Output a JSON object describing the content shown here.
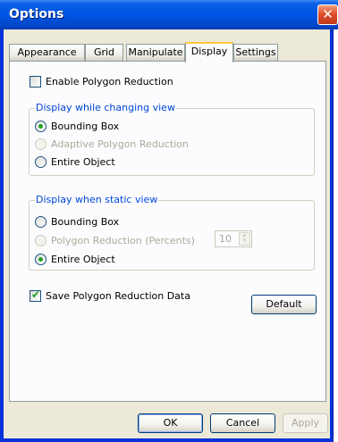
{
  "window": {
    "title": "Options",
    "close_glyph": "✕"
  },
  "tabs": [
    {
      "label": "Appearance"
    },
    {
      "label": "Grid"
    },
    {
      "label": "Manipulate"
    },
    {
      "label": "Display"
    },
    {
      "label": "Settings"
    }
  ],
  "active_tab": "Display",
  "display": {
    "enable_polygon_reduction": {
      "label": "Enable Polygon Reduction",
      "checked": false
    },
    "changing_view": {
      "title": "Display while changing view",
      "options": [
        {
          "label": "Bounding Box",
          "selected": true,
          "enabled": true
        },
        {
          "label": "Adaptive Polygon Reduction",
          "selected": false,
          "enabled": false
        },
        {
          "label": "Entire Object",
          "selected": false,
          "enabled": true
        }
      ]
    },
    "static_view": {
      "title": "Display when static view",
      "options": [
        {
          "label": "Bounding Box",
          "selected": false,
          "enabled": true
        },
        {
          "label": "Polygon Reduction (Percents)",
          "selected": false,
          "enabled": false
        },
        {
          "label": "Entire Object",
          "selected": true,
          "enabled": true
        }
      ],
      "percent_value": "10"
    },
    "save_reduction_data": {
      "label": "Save Polygon Reduction Data",
      "checked": true
    },
    "default_button": "Default"
  },
  "footer": {
    "ok": "OK",
    "cancel": "Cancel",
    "apply": "Apply"
  }
}
